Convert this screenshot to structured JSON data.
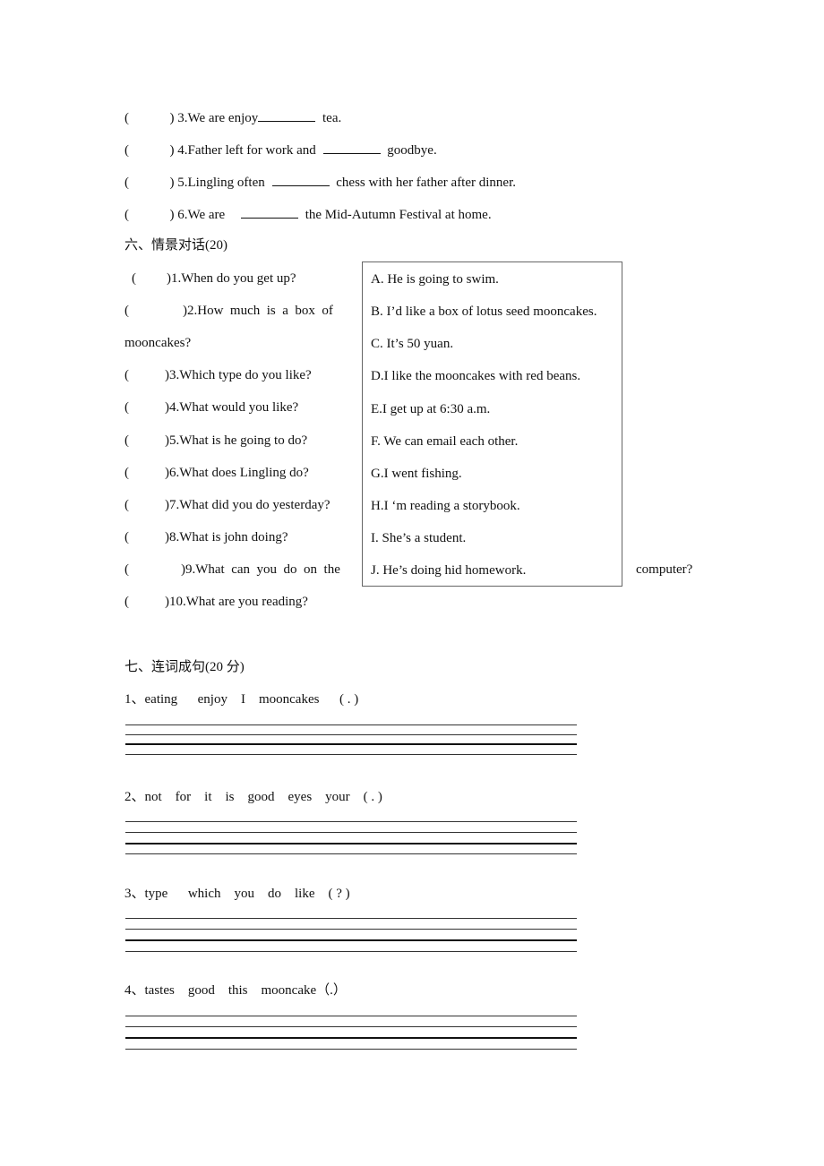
{
  "fill_blank": {
    "items": [
      {
        "paren": "(",
        "close": ")",
        "num_text": "3.We are enjoy",
        "after": "tea."
      },
      {
        "paren": "(",
        "close": ")",
        "num_text": "4.Father left for work and",
        "after": "goodbye."
      },
      {
        "paren": "(",
        "close": ")",
        "num_text": "5.Lingling often",
        "after": "chess with her father after dinner."
      },
      {
        "paren": "(",
        "close": ")",
        "num_text": "6.We are",
        "after": "the Mid-Autumn Festival at home."
      }
    ]
  },
  "section6": {
    "title": "六、情景对话(20)",
    "questions": [
      {
        "paren": "(",
        "text": ")1.When do you get up?"
      },
      {
        "paren": "(",
        "text": ")2.How  much  is  a  box  of"
      },
      {
        "paren": "",
        "text": "mooncakes?"
      },
      {
        "paren": "(",
        "text": ")3.Which type do you like?"
      },
      {
        "paren": "(",
        "text": ")4.What would you like?"
      },
      {
        "paren": "(",
        "text": ")5.What is he going to do?"
      },
      {
        "paren": "(",
        "text": ")6.What does Lingling do?"
      },
      {
        "paren": "(",
        "text": ")7.What did you do yesterday?"
      },
      {
        "paren": "(",
        "text": ")8.What is john doing?"
      },
      {
        "paren": "(",
        "text": ")9.What  can  you  do  on  the"
      },
      {
        "paren": "(",
        "text": ")10.What are you reading?"
      }
    ],
    "q9_continuation": "computer?",
    "options": [
      "A. He is going to swim.",
      "B. I’d like a box of lotus seed mooncakes.",
      "C. It’s 50 yuan.",
      "D.I like the mooncakes with red beans.",
      "E.I get up at 6:30 a.m.",
      "F. We can email each other.",
      "G.I went fishing.",
      "H.I ‘m reading a storybook.",
      "I. She’s a student.",
      "J. He’s doing hid homework."
    ]
  },
  "section7": {
    "title": "七、连词成句(20 分)",
    "items": [
      {
        "label": "1、eating      enjoy    I    mooncakes      ( . )"
      },
      {
        "label": "2、not    for    it    is    good    eyes    your    ( . )"
      },
      {
        "label": "3、type      which    you    do    like    ( ? )"
      },
      {
        "label": "4、tastes    good    this    mooncake（.）"
      }
    ]
  }
}
